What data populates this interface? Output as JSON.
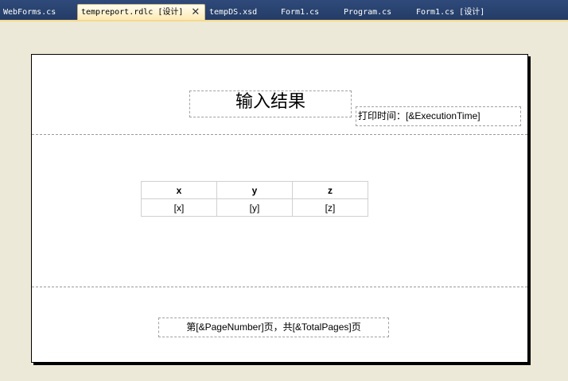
{
  "tabs": [
    {
      "label": "WebForms.cs"
    },
    {
      "label": "tempreport.rdlc [设计]",
      "active": true
    },
    {
      "label": "tempDS.xsd"
    },
    {
      "label": "Form1.cs"
    },
    {
      "label": "Program.cs"
    },
    {
      "label": "Form1.cs [设计]"
    }
  ],
  "report": {
    "title": "输入结果",
    "print_time": "打印时间：[&ExecutionTime]",
    "table": {
      "headers": [
        "x",
        "y",
        "z"
      ],
      "row": [
        "[x]",
        "[y]",
        "[z]"
      ]
    },
    "footer": "第[&PageNumber]页，共[&TotalPages]页"
  }
}
